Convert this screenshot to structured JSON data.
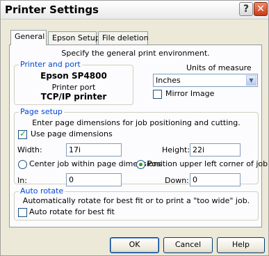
{
  "window": {
    "title": "Printer Settings"
  },
  "titlebar": {
    "help_glyph": "?",
    "close_glyph": "✕"
  },
  "tabs": [
    {
      "label": "General",
      "active": true
    },
    {
      "label": "Epson Setup",
      "active": false
    },
    {
      "label": "File deletion",
      "active": false
    }
  ],
  "general": {
    "description": "Specify the general print environment.",
    "printer_port_group": {
      "legend": "Printer and port",
      "printer_name": "Epson SP4800",
      "port_label": "Printer port",
      "port_value": "TCP/IP printer"
    },
    "units": {
      "label": "Units of measure",
      "selected": "Inches",
      "mirror_label": "Mirror Image",
      "mirror_checked": false
    },
    "page_setup": {
      "legend": "Page setup",
      "description": "Enter page dimensions for job positioning and cutting.",
      "use_dimensions_label": "Use page dimensions",
      "use_dimensions_checked": true,
      "width_label": "Width:",
      "width_value": "17i",
      "height_label": "Height:",
      "height_value": "22i",
      "center_label": "Center job within page dimensions",
      "upper_left_label": "Position upper left corner of job",
      "position_mode": "upper-left",
      "in_label": "In:",
      "in_value": "0",
      "down_label": "Down:",
      "down_value": "0"
    },
    "auto_rotate": {
      "legend": "Auto rotate",
      "description": "Automatically rotate for best fit or to print a \"too wide\" job.",
      "checkbox_label": "Auto rotate for best fit",
      "checked": false
    }
  },
  "buttons": {
    "ok": "OK",
    "cancel": "Cancel",
    "help": "Help"
  },
  "colors": {
    "legend_blue": "#0046d5",
    "accent_green": "#21a121",
    "window_bg": "#ece9d8"
  }
}
